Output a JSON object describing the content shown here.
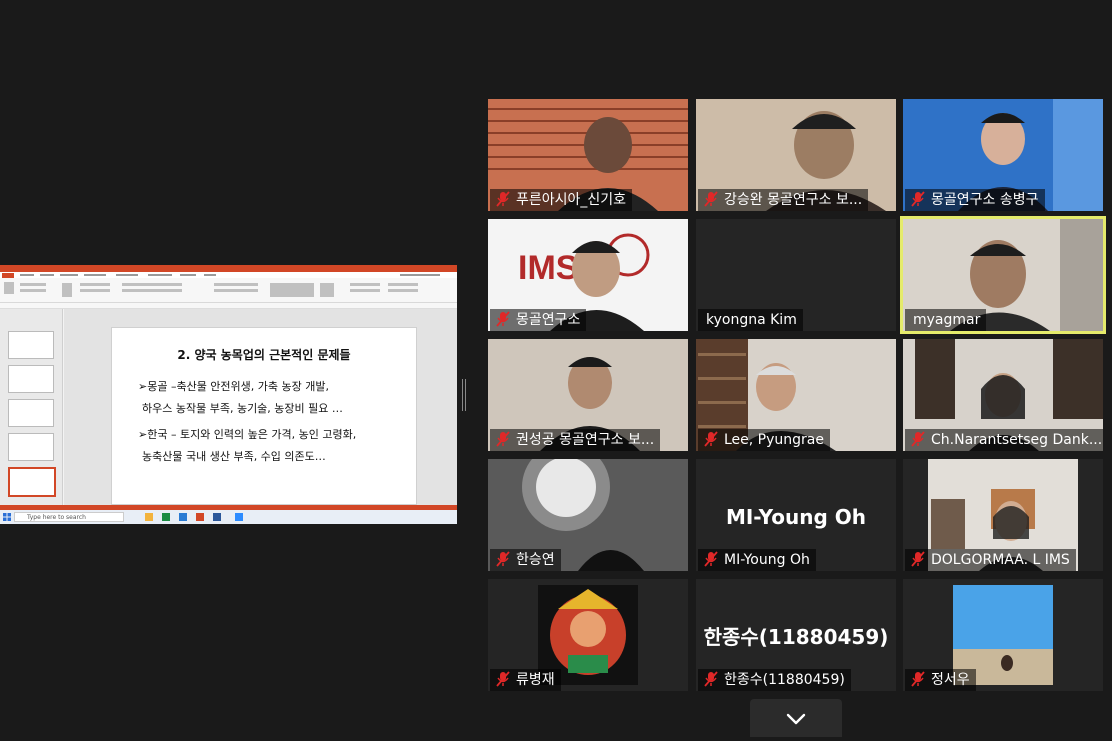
{
  "shared_screen": {
    "slide_title": "2. 양국 농목업의 근본적인 문제들",
    "bullets": [
      "➢몽골 –축산물 안전위생, 가축 농장 개발,",
      "하우스 농작물 부족, 농기술, 농장비 필요 …",
      "➢한국 – 토지와 인력의 높은 가격, 농인 고령화,",
      "농축산물 국내 생산 부족, 수입 의존도…"
    ],
    "taskbar_search": "Type here to search"
  },
  "participants": [
    {
      "name": "푸른아시아_신기호",
      "muted": true
    },
    {
      "name": "강승완 몽골연구소 보...",
      "muted": true
    },
    {
      "name": "몽골연구소 송병구",
      "muted": true
    },
    {
      "name": "몽골연구소",
      "muted": true
    },
    {
      "name": "kyongna Kim",
      "muted": false
    },
    {
      "name": "myagmar",
      "muted": false,
      "active_speaker": true
    },
    {
      "name": "권성공 몽골연구소 보...",
      "muted": true
    },
    {
      "name": "Lee, Pyungrae",
      "muted": true
    },
    {
      "name": "Ch.Narantsetseg Dank...",
      "muted": true
    },
    {
      "name": "한승연",
      "muted": true
    },
    {
      "name": "MI-Young Oh",
      "muted": true,
      "center_text": "MI-Young Oh"
    },
    {
      "name": "DOLGORMAA. L IMS",
      "muted": true
    },
    {
      "name": "류병재",
      "muted": true
    },
    {
      "name": "한종수(11880459)",
      "muted": true,
      "center_text": "한종수(11880459)"
    },
    {
      "name": "정서우",
      "muted": true
    }
  ],
  "icons": {
    "mute": "microphone-muted-icon",
    "pager": "chevron-down-icon",
    "split": "split-handle-icon"
  },
  "colors": {
    "background": "#1a1a1a",
    "active_speaker_border": "#e5eb6b",
    "mute_red": "#e02828",
    "powerpoint_red": "#d24726"
  }
}
